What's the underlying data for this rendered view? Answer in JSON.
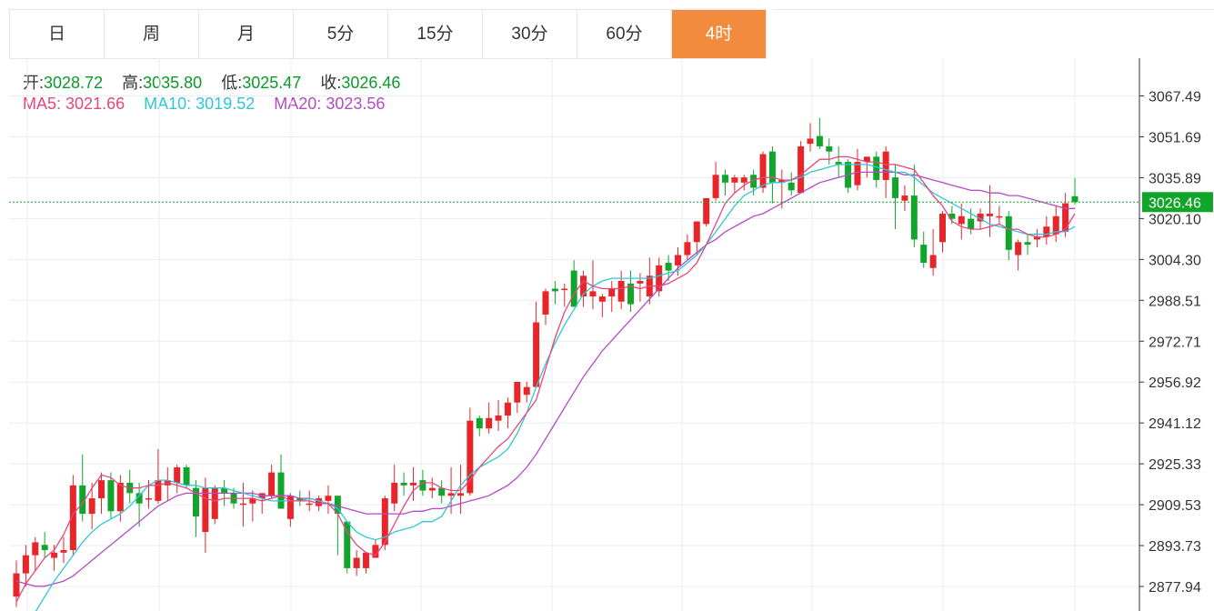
{
  "tabs": [
    {
      "label": "日",
      "active": false
    },
    {
      "label": "周",
      "active": false
    },
    {
      "label": "月",
      "active": false
    },
    {
      "label": "5分",
      "active": false
    },
    {
      "label": "15分",
      "active": false
    },
    {
      "label": "30分",
      "active": false
    },
    {
      "label": "60分",
      "active": false
    },
    {
      "label": "4时",
      "active": true
    }
  ],
  "ohlc": {
    "open_label": "开:",
    "open": "3028.72",
    "high_label": "高:",
    "high": "3035.80",
    "low_label": "低:",
    "low": "3025.47",
    "close_label": "收:",
    "close": "3026.46"
  },
  "ma": {
    "ma5_label": "MA5:",
    "ma5": "3021.66",
    "ma10_label": "MA10:",
    "ma10": "3019.52",
    "ma20_label": "MA20:",
    "ma20": "3023.56"
  },
  "colors": {
    "up": "#e8262a",
    "down": "#12a52b",
    "ma5": "#e6467d",
    "ma10": "#2fc7d4",
    "ma20": "#b44bc2",
    "active_tab": "#f38b3f",
    "price_tag": "#12a52b"
  },
  "chart_data": {
    "type": "candlestick",
    "y_ticks": [
      "3067.49",
      "3051.69",
      "3035.89",
      "3020.10",
      "3004.30",
      "2988.51",
      "2972.71",
      "2956.92",
      "2941.12",
      "2925.33",
      "2909.53",
      "2893.73",
      "2877.94"
    ],
    "ylim": [
      2877.94,
      3067.49
    ],
    "last_price": "3026.46",
    "candles": [
      [
        2874.0,
        2888.0,
        2870.0,
        2883.0
      ],
      [
        2883.0,
        2894.0,
        2878.0,
        2890.0
      ],
      [
        2890.0,
        2897.0,
        2884.0,
        2895.0
      ],
      [
        2894.0,
        2899.0,
        2889.0,
        2892.0
      ],
      [
        2889.0,
        2894.0,
        2884.0,
        2891.0
      ],
      [
        2891.0,
        2897.0,
        2887.0,
        2892.0
      ],
      [
        2892.0,
        2921.0,
        2890.0,
        2917.0
      ],
      [
        2917.0,
        2929.0,
        2903.0,
        2906.0
      ],
      [
        2906.0,
        2918.0,
        2900.0,
        2912.0
      ],
      [
        2912.0,
        2922.0,
        2906.0,
        2919.0
      ],
      [
        2919.0,
        2922.0,
        2904.0,
        2907.0
      ],
      [
        2907.0,
        2921.0,
        2903.0,
        2918.0
      ],
      [
        2918.0,
        2923.0,
        2910.0,
        2914.0
      ],
      [
        2914.0,
        2918.0,
        2901.0,
        2910.0
      ],
      [
        2912.0,
        2919.0,
        2908.0,
        2912.0
      ],
      [
        2911.0,
        2931.0,
        2910.0,
        2919.0
      ],
      [
        2917.0,
        2924.0,
        2911.0,
        2919.0
      ],
      [
        2918.0,
        2925.0,
        2914.0,
        2924.0
      ],
      [
        2924.0,
        2925.0,
        2916.0,
        2917.0
      ],
      [
        2916.0,
        2919.0,
        2897.0,
        2905.0
      ],
      [
        2899.0,
        2920.0,
        2891.0,
        2916.0
      ],
      [
        2904.0,
        2917.0,
        2902.0,
        2916.0
      ],
      [
        2916.0,
        2919.0,
        2909.0,
        2914.0
      ],
      [
        2914.0,
        2916.0,
        2908.0,
        2910.0
      ],
      [
        2910.0,
        2918.0,
        2901.0,
        2910.0
      ],
      [
        2910.0,
        2915.0,
        2903.0,
        2912.0
      ],
      [
        2912.0,
        2914.0,
        2906.0,
        2914.0
      ],
      [
        2913.0,
        2925.0,
        2912.0,
        2922.0
      ],
      [
        2922.0,
        2929.0,
        2908.0,
        2908.0
      ],
      [
        2904.0,
        2914.0,
        2901.0,
        2913.0
      ],
      [
        2912.0,
        2915.0,
        2909.0,
        2911.0
      ],
      [
        2910.0,
        2915.0,
        2907.0,
        2910.0
      ],
      [
        2909.0,
        2913.0,
        2907.0,
        2912.0
      ],
      [
        2911.0,
        2917.0,
        2906.0,
        2913.0
      ],
      [
        2913.0,
        2906.0,
        2890.0,
        2906.0
      ],
      [
        2903.0,
        2903.0,
        2883.0,
        2885.0
      ],
      [
        2885.0,
        2892.0,
        2882.0,
        2889.0
      ],
      [
        2885.0,
        2891.0,
        2883.0,
        2891.0
      ],
      [
        2889.0,
        2896.0,
        2889.0,
        2894.0
      ],
      [
        2894.0,
        2913.0,
        2892.0,
        2912.0
      ],
      [
        2910.0,
        2925.0,
        2907.0,
        2918.0
      ],
      [
        2918.0,
        2922.0,
        2913.0,
        2917.0
      ],
      [
        2917.0,
        2924.0,
        2911.0,
        2918.0
      ],
      [
        2919.0,
        2923.0,
        2913.0,
        2915.0
      ],
      [
        2915.0,
        2920.0,
        2912.0,
        2916.0
      ],
      [
        2916.0,
        2919.0,
        2910.0,
        2913.0
      ],
      [
        2913.0,
        2924.0,
        2906.0,
        2914.0
      ],
      [
        2913.0,
        2925.0,
        2906.0,
        2914.0
      ],
      [
        2914.0,
        2947.0,
        2913.0,
        2942.0
      ],
      [
        2943.0,
        2944.0,
        2936.0,
        2939.0
      ],
      [
        2939.0,
        2949.0,
        2937.0,
        2943.0
      ],
      [
        2942.0,
        2950.0,
        2938.0,
        2944.0
      ],
      [
        2944.0,
        2951.0,
        2939.0,
        2949.0
      ],
      [
        2949.0,
        2957.0,
        2945.0,
        2957.0
      ],
      [
        2952.0,
        2957.0,
        2949.0,
        2955.0
      ],
      [
        2955.0,
        2988.0,
        2955.0,
        2980.0
      ],
      [
        2983.0,
        2993.0,
        2979.0,
        2992.0
      ],
      [
        2993.0,
        2996.0,
        2987.0,
        2992.0
      ],
      [
        2993.0,
        2995.0,
        2986.0,
        2993.0
      ],
      [
        3000.0,
        3004.0,
        2986.0,
        2986.0
      ],
      [
        2990.0,
        3000.0,
        2986.0,
        2998.0
      ],
      [
        2990.0,
        3004.0,
        2985.0,
        2992.0
      ],
      [
        2988.0,
        2991.0,
        2982.0,
        2990.0
      ],
      [
        2990.0,
        2996.0,
        2984.0,
        2993.0
      ],
      [
        2988.0,
        3000.0,
        2985.0,
        2996.0
      ],
      [
        2995.0,
        3000.0,
        2984.0,
        2987.0
      ],
      [
        2995.0,
        2999.0,
        2988.0,
        2996.0
      ],
      [
        2990.0,
        3005.0,
        2987.0,
        2998.0
      ],
      [
        2992.0,
        3005.0,
        2990.0,
        3002.0
      ],
      [
        3003.0,
        3006.0,
        2996.0,
        3000.0
      ],
      [
        3002.0,
        3009.0,
        2998.0,
        3006.0
      ],
      [
        3006.0,
        3014.0,
        3004.0,
        3011.0
      ],
      [
        3011.0,
        3019.0,
        3006.0,
        3019.0
      ],
      [
        3018.0,
        3028.0,
        3017.0,
        3028.0
      ],
      [
        3028.0,
        3042.0,
        3027.0,
        3037.0
      ],
      [
        3037.0,
        3039.0,
        3029.0,
        3034.0
      ],
      [
        3034.0,
        3037.0,
        3030.0,
        3036.0
      ],
      [
        3034.0,
        3037.0,
        3031.0,
        3036.0
      ],
      [
        3037.0,
        3039.0,
        3029.0,
        3032.0
      ],
      [
        3032.0,
        3046.0,
        3030.0,
        3045.0
      ],
      [
        3046.0,
        3048.0,
        3026.0,
        3034.0
      ],
      [
        3034.0,
        3039.0,
        3024.0,
        3035.0
      ],
      [
        3034.0,
        3038.0,
        3029.0,
        3031.0
      ],
      [
        3030.0,
        3050.0,
        3030.0,
        3048.0
      ],
      [
        3049.0,
        3057.0,
        3046.0,
        3051.0
      ],
      [
        3052.0,
        3059.0,
        3047.0,
        3048.0
      ],
      [
        3048.0,
        3051.0,
        3041.0,
        3046.0
      ],
      [
        3042.0,
        3048.0,
        3036.0,
        3041.0
      ],
      [
        3042.0,
        3043.0,
        3030.0,
        3032.0
      ],
      [
        3033.0,
        3047.0,
        3031.0,
        3042.0
      ],
      [
        3042.0,
        3044.0,
        3036.0,
        3044.0
      ],
      [
        3044.0,
        3046.0,
        3032.0,
        3035.0
      ],
      [
        3035.0,
        3048.0,
        3028.0,
        3046.0
      ],
      [
        3036.0,
        3041.0,
        3016.0,
        3028.0
      ],
      [
        3027.0,
        3033.0,
        3023.0,
        3029.0
      ],
      [
        3029.0,
        3041.0,
        3009.0,
        3012.0
      ],
      [
        3010.0,
        3015.0,
        3001.0,
        3003.0
      ],
      [
        3001.0,
        3016.0,
        2998.0,
        3006.0
      ],
      [
        3011.0,
        3023.0,
        3007.0,
        3022.0
      ],
      [
        3022.0,
        3025.0,
        3018.0,
        3020.0
      ],
      [
        3018.0,
        3026.0,
        3012.0,
        3021.0
      ],
      [
        3020.0,
        3024.0,
        3014.0,
        3016.0
      ],
      [
        3019.0,
        3024.0,
        3016.0,
        3022.0
      ],
      [
        3021.0,
        3033.0,
        3013.0,
        3022.0
      ],
      [
        3021.0,
        3025.0,
        3018.0,
        3021.0
      ],
      [
        3021.0,
        3023.0,
        3004.0,
        3008.0
      ],
      [
        3006.0,
        3012.0,
        3000.0,
        3011.0
      ],
      [
        3011.0,
        3014.0,
        3006.0,
        3010.0
      ],
      [
        3012.0,
        3016.0,
        3009.0,
        3013.0
      ],
      [
        3013.0,
        3021.0,
        3010.0,
        3017.0
      ],
      [
        3014.0,
        3025.0,
        3011.0,
        3021.0
      ],
      [
        3015.0,
        3030.0,
        3013.0,
        3026.0
      ],
      [
        3028.72,
        3035.8,
        3025.47,
        3026.46
      ]
    ],
    "ma5": [
      2872,
      2879,
      2884,
      2889,
      2892,
      2898,
      2906,
      2910,
      2916,
      2921,
      2920,
      2917,
      2916,
      2916,
      2917,
      2917,
      2918,
      2917,
      2916,
      2914,
      2912,
      2911,
      2912,
      2912,
      2912,
      2912,
      2911,
      2912,
      2913,
      2911,
      2911,
      2911,
      2910,
      2910,
      2906,
      2899,
      2894,
      2891,
      2890,
      2895,
      2902,
      2909,
      2915,
      2918,
      2918,
      2916,
      2915,
      2915,
      2919,
      2924,
      2928,
      2932,
      2935,
      2940,
      2945,
      2950,
      2962,
      2974,
      2984,
      2991,
      2996,
      2994,
      2993,
      2993,
      2993,
      2994,
      2993,
      2994,
      2994,
      2995,
      2997,
      2999,
      3003,
      3010,
      3018,
      3026,
      3030,
      3033,
      3035,
      3036,
      3036,
      3035,
      3035,
      3037,
      3040,
      3043,
      3043,
      3044,
      3044,
      3043,
      3042,
      3042,
      3041,
      3041,
      3040,
      3039,
      3034,
      3029,
      3025,
      3019,
      3017,
      3016,
      3016,
      3017,
      3018,
      3016,
      3016,
      3014,
      3013,
      3013,
      3014,
      3016,
      3022
    ],
    "ma10": [
      2858,
      2862,
      2868,
      2874,
      2880,
      2885,
      2890,
      2895,
      2899,
      2902,
      2904,
      2906,
      2909,
      2913,
      2917,
      2919,
      2919,
      2918,
      2917,
      2917,
      2916,
      2916,
      2916,
      2915,
      2914,
      2913,
      2912,
      2911,
      2911,
      2911,
      2911,
      2912,
      2911,
      2910,
      2908,
      2903,
      2899,
      2897,
      2896,
      2897,
      2899,
      2900,
      2901,
      2903,
      2903,
      2905,
      2911,
      2917,
      2921,
      2924,
      2926,
      2928,
      2931,
      2937,
      2945,
      2955,
      2964,
      2972,
      2979,
      2985,
      2991,
      2994,
      2996,
      2997,
      2997,
      2997,
      2997,
      2997,
      2998,
      2999,
      3000,
      3003,
      3006,
      3010,
      3015,
      3020,
      3025,
      3029,
      3031,
      3033,
      3034,
      3034,
      3035,
      3036,
      3038,
      3039,
      3040,
      3041,
      3041,
      3041,
      3041,
      3040,
      3039,
      3038,
      3038,
      3036,
      3033,
      3030,
      3028,
      3026,
      3024,
      3022,
      3020,
      3018,
      3017,
      3016,
      3015,
      3014,
      3014,
      3014,
      3015,
      3015,
      3017
    ],
    "ma20": [
      2880,
      2879,
      2878,
      2878,
      2879,
      2880,
      2882,
      2885,
      2888,
      2891,
      2894,
      2897,
      2900,
      2903,
      2906,
      2909,
      2911,
      2913,
      2914,
      2914,
      2914,
      2914,
      2914,
      2914,
      2914,
      2914,
      2913,
      2913,
      2913,
      2913,
      2912,
      2912,
      2911,
      2910,
      2909,
      2908,
      2907,
      2906,
      2906,
      2906,
      2906,
      2906,
      2907,
      2907,
      2908,
      2908,
      2909,
      2910,
      2911,
      2912,
      2913,
      2915,
      2917,
      2920,
      2924,
      2929,
      2935,
      2941,
      2947,
      2953,
      2959,
      2964,
      2969,
      2973,
      2977,
      2981,
      2985,
      2989,
      2993,
      2997,
      3001,
      3004,
      3007,
      3010,
      3012,
      3015,
      3017,
      3019,
      3021,
      3022,
      3024,
      3026,
      3028,
      3030,
      3032,
      3034,
      3035,
      3036,
      3037,
      3038,
      3038,
      3038,
      3038,
      3038,
      3037,
      3037,
      3036,
      3035,
      3034,
      3033,
      3032,
      3031,
      3031,
      3030,
      3030,
      3029,
      3029,
      3028,
      3027,
      3026,
      3025,
      3024,
      3024
    ]
  }
}
